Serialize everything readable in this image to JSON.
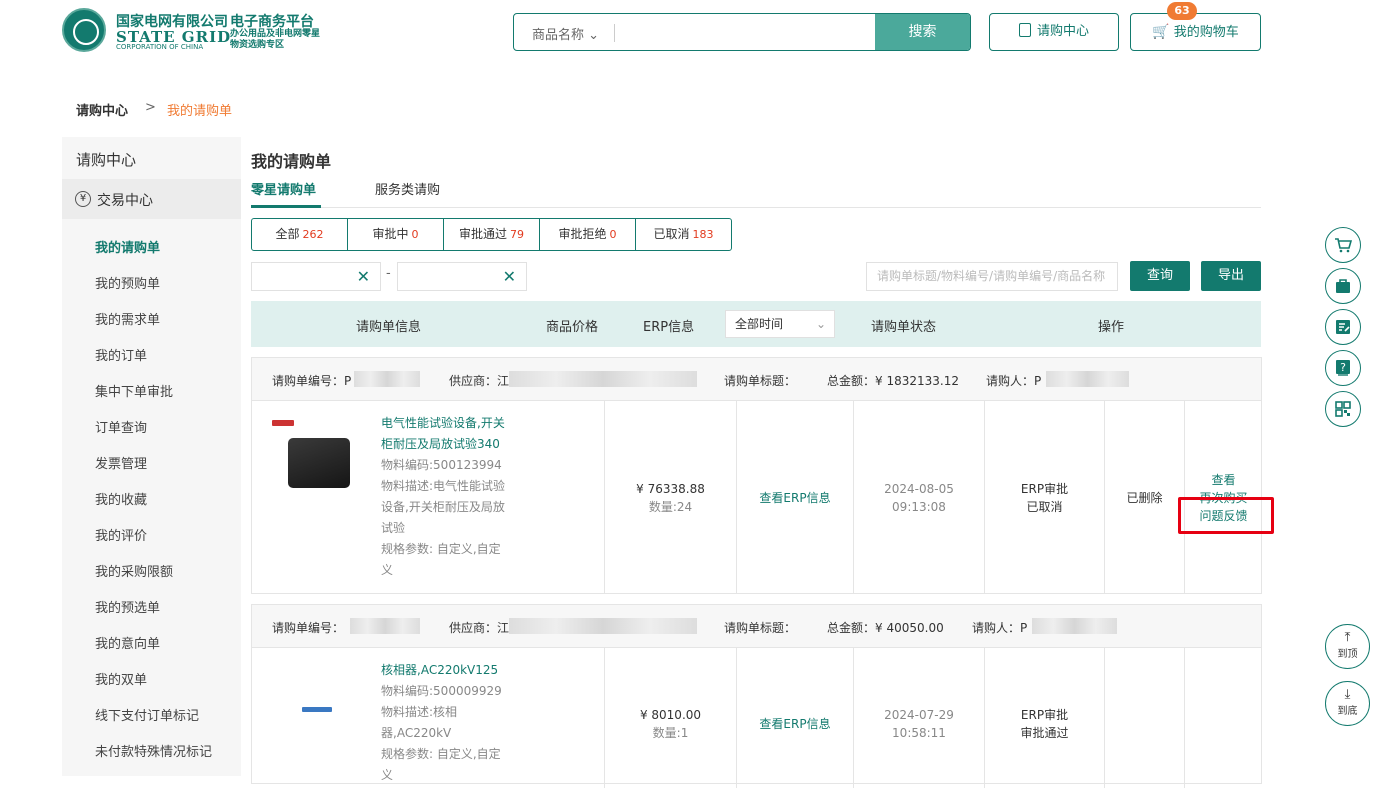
{
  "header": {
    "logo_cn": "国家电网有限公司",
    "logo_en": "STATE GRID",
    "logo_en_sub": "CORPORATION OF CHINA",
    "platform": "电子商务平台",
    "platform_sub": "办公用品及非电网零星物资选购专区",
    "search_category": "商品名称",
    "search_placeholder": "",
    "search_button": "搜索",
    "purchase_center": "请购中心",
    "cart": "我的购物车",
    "cart_count": "63"
  },
  "breadcrumb": {
    "root": "请购中心",
    "sep": ">",
    "current": "我的请购单"
  },
  "sidebar": {
    "title": "请购中心",
    "section": "交易中心",
    "items": [
      "我的请购单",
      "我的预购单",
      "我的需求单",
      "我的订单",
      "集中下单审批",
      "订单查询",
      "发票管理",
      "我的收藏",
      "我的评价",
      "我的采购限额",
      "我的预选单",
      "我的意向单",
      "我的双单",
      "线下支付订单标记",
      "未付款特殊情况标记"
    ]
  },
  "main": {
    "title": "我的请购单",
    "tabs": [
      "零星请购单",
      "服务类请购"
    ],
    "filters": [
      {
        "label": "全部",
        "count": "262"
      },
      {
        "label": "审批中",
        "count": "0"
      },
      {
        "label": "审批通过",
        "count": "79"
      },
      {
        "label": "审批拒绝",
        "count": "0"
      },
      {
        "label": "已取消",
        "count": "183"
      }
    ],
    "date_sep": "-",
    "keyword_placeholder": "请购单标题/物料编号/请购单编号/商品名称",
    "query_button": "查询",
    "export_button": "导出",
    "columns": [
      "请购单信息",
      "商品价格",
      "ERP信息",
      "全部时间",
      "请购单状态",
      "操作"
    ]
  },
  "orders": [
    {
      "no_label": "请购单编号：",
      "no_prefix": "P",
      "supplier_label": "供应商：",
      "supplier_prefix": "江",
      "title_label": "请购单标题：",
      "total_label": "总金额：",
      "total": "¥ 1832133.12",
      "buyer_label": "请购人：",
      "buyer_prefix": "P",
      "product_title": "电气性能试验设备,开关柜耐压及局放试验340",
      "product_code": "物料编码:500123994",
      "product_desc": "物料描述:电气性能试验设备,开关柜耐压及局放试验",
      "product_spec": "规格参数: 自定义,自定义",
      "price": "¥ 76338.88",
      "qty": "数量:24",
      "erp": "查看ERP信息",
      "date": "2024-08-05",
      "time": "09:13:08",
      "status1": "ERP审批",
      "status2": "已取消",
      "deleted": "已删除",
      "op1": "查看",
      "op2": "再次购买",
      "op3": "问题反馈"
    },
    {
      "no_label": "请购单编号：",
      "no_prefix": "",
      "supplier_label": "供应商：",
      "supplier_prefix": "江",
      "title_label": "请购单标题：",
      "total_label": "总金额：",
      "total": "¥ 40050.00",
      "buyer_label": "请购人：",
      "buyer_prefix": "P",
      "product_title": "核相器,AC220kV125",
      "product_code": "物料编码:500009929",
      "product_desc": "物料描述:核相器,AC220kV",
      "product_spec": "规格参数: 自定义,自定义",
      "price": "¥ 8010.00",
      "qty": "数量:1",
      "erp": "查看ERP信息",
      "date": "2024-07-29",
      "time": "10:58:11",
      "status1": "ERP审批",
      "status2": "审批通过"
    }
  ],
  "float": {
    "top": "到顶",
    "bottom": "到底"
  },
  "colors": {
    "brand": "#137a6e",
    "accent": "#f07b33",
    "highlight": "#e60012"
  }
}
